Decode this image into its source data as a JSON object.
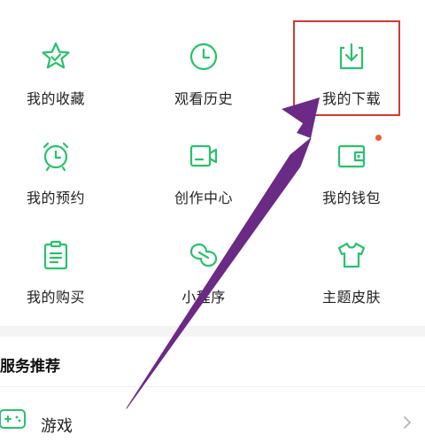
{
  "colors": {
    "accent_green": "#27c26b",
    "badge_red": "#f25a3c",
    "highlight_red": "#d23a32",
    "annotation_purple": "#6b2a86"
  },
  "grid": {
    "items": [
      {
        "label": "我的收藏",
        "icon": "star-icon"
      },
      {
        "label": "观看历史",
        "icon": "clock-icon"
      },
      {
        "label": "我的下载",
        "icon": "download-icon"
      },
      {
        "label": "我的预约",
        "icon": "alarm-clock-icon"
      },
      {
        "label": "创作中心",
        "icon": "video-camera-icon"
      },
      {
        "label": "我的钱包",
        "icon": "wallet-icon"
      },
      {
        "label": "我的购买",
        "icon": "clipboard-icon"
      },
      {
        "label": "小程序",
        "icon": "mini-program-icon"
      },
      {
        "label": "主题皮肤",
        "icon": "tshirt-icon"
      }
    ]
  },
  "services": {
    "title": "服务推荐",
    "rows": [
      {
        "label": "游戏",
        "icon": "gamepad-icon"
      }
    ]
  }
}
